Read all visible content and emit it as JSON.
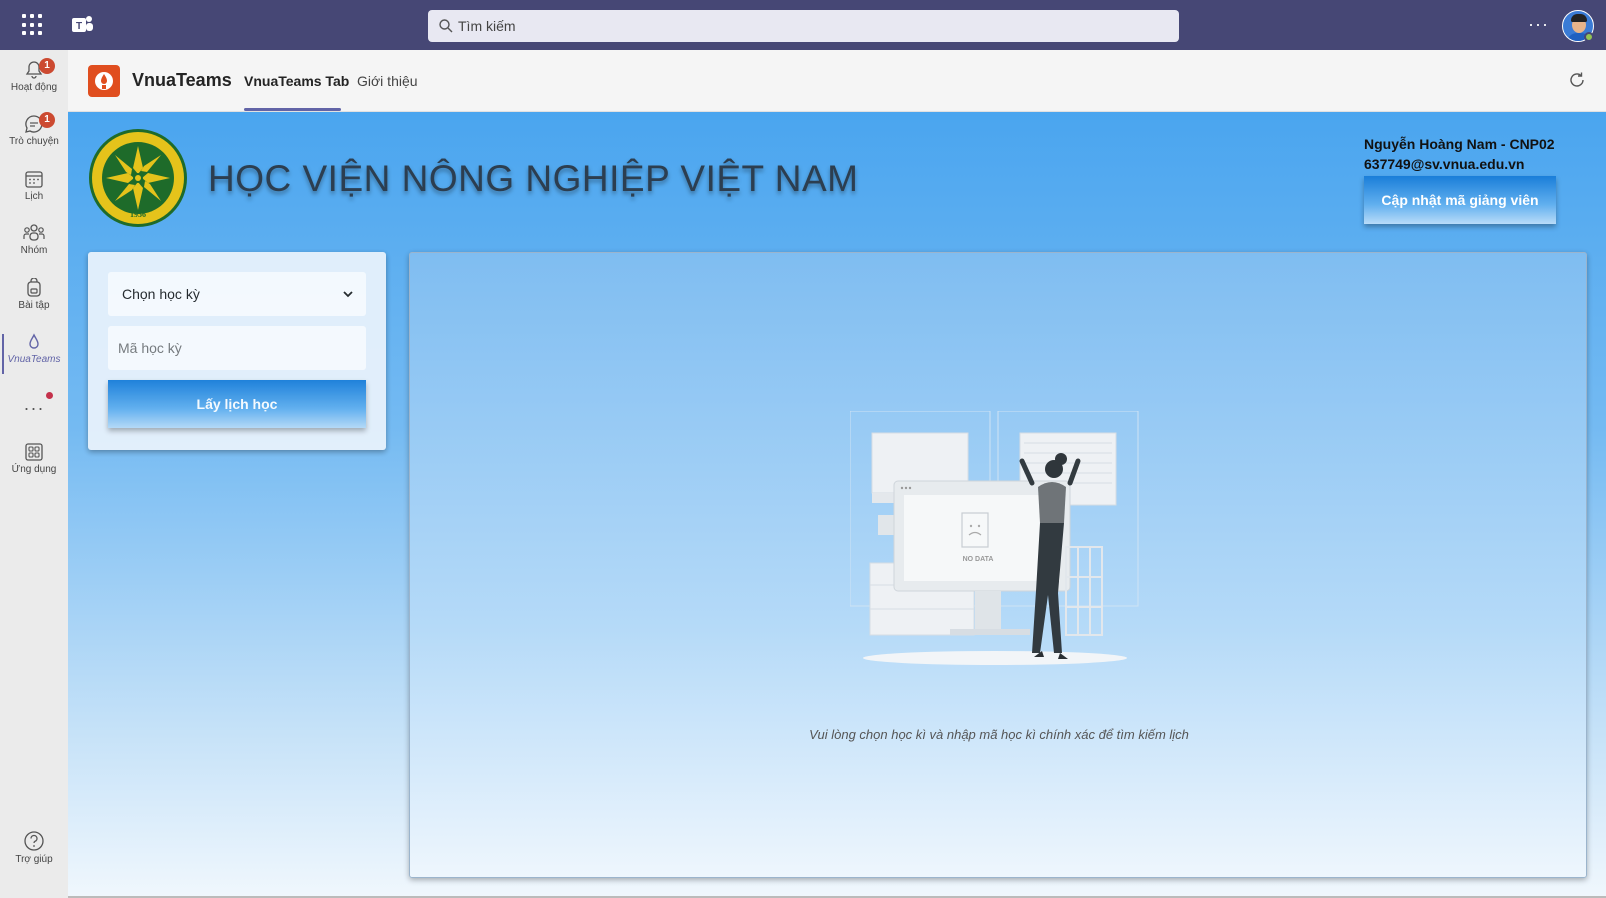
{
  "topbar": {
    "search_placeholder": "Tìm kiếm",
    "more_label": "···",
    "accent_color": "#464775"
  },
  "rail": {
    "items": [
      {
        "label": "Hoạt động",
        "icon": "bell-icon",
        "badge": "1"
      },
      {
        "label": "Trò chuyện",
        "icon": "chat-icon",
        "badge": "1"
      },
      {
        "label": "Lịch",
        "icon": "calendar-icon"
      },
      {
        "label": "Nhóm",
        "icon": "teams-icon"
      },
      {
        "label": "Bài tập",
        "icon": "backpack-icon"
      },
      {
        "label": "VnuaTeams",
        "icon": "app-drop-icon",
        "active": true
      }
    ],
    "more_label": "···",
    "apps_label": "Ứng dụng",
    "help_label": "Trợ giúp"
  },
  "app_header": {
    "app_name": "VnuaTeams",
    "tabs": [
      {
        "label": "VnuaTeams Tab",
        "active": true
      },
      {
        "label": "Giới thiệu",
        "active": false
      }
    ]
  },
  "banner": {
    "school_name": "HỌC VIỆN NÔNG NGHIỆP VIỆT NAM",
    "seal_year": "1956",
    "user_name": "Nguyễn Hoàng Nam - CNP02",
    "user_email": "637749@sv.vnua.edu.vn",
    "update_button": "Cập nhật mã giảng viên"
  },
  "form": {
    "semester_select": "Chọn học kỳ",
    "semester_code_placeholder": "Mã học kỳ",
    "fetch_button": "Lấy lịch học"
  },
  "result": {
    "no_data_label": "NO DATA",
    "empty_message": "Vui lòng chọn học kì và nhập mã học kì chính xác để tìm kiếm lịch"
  }
}
